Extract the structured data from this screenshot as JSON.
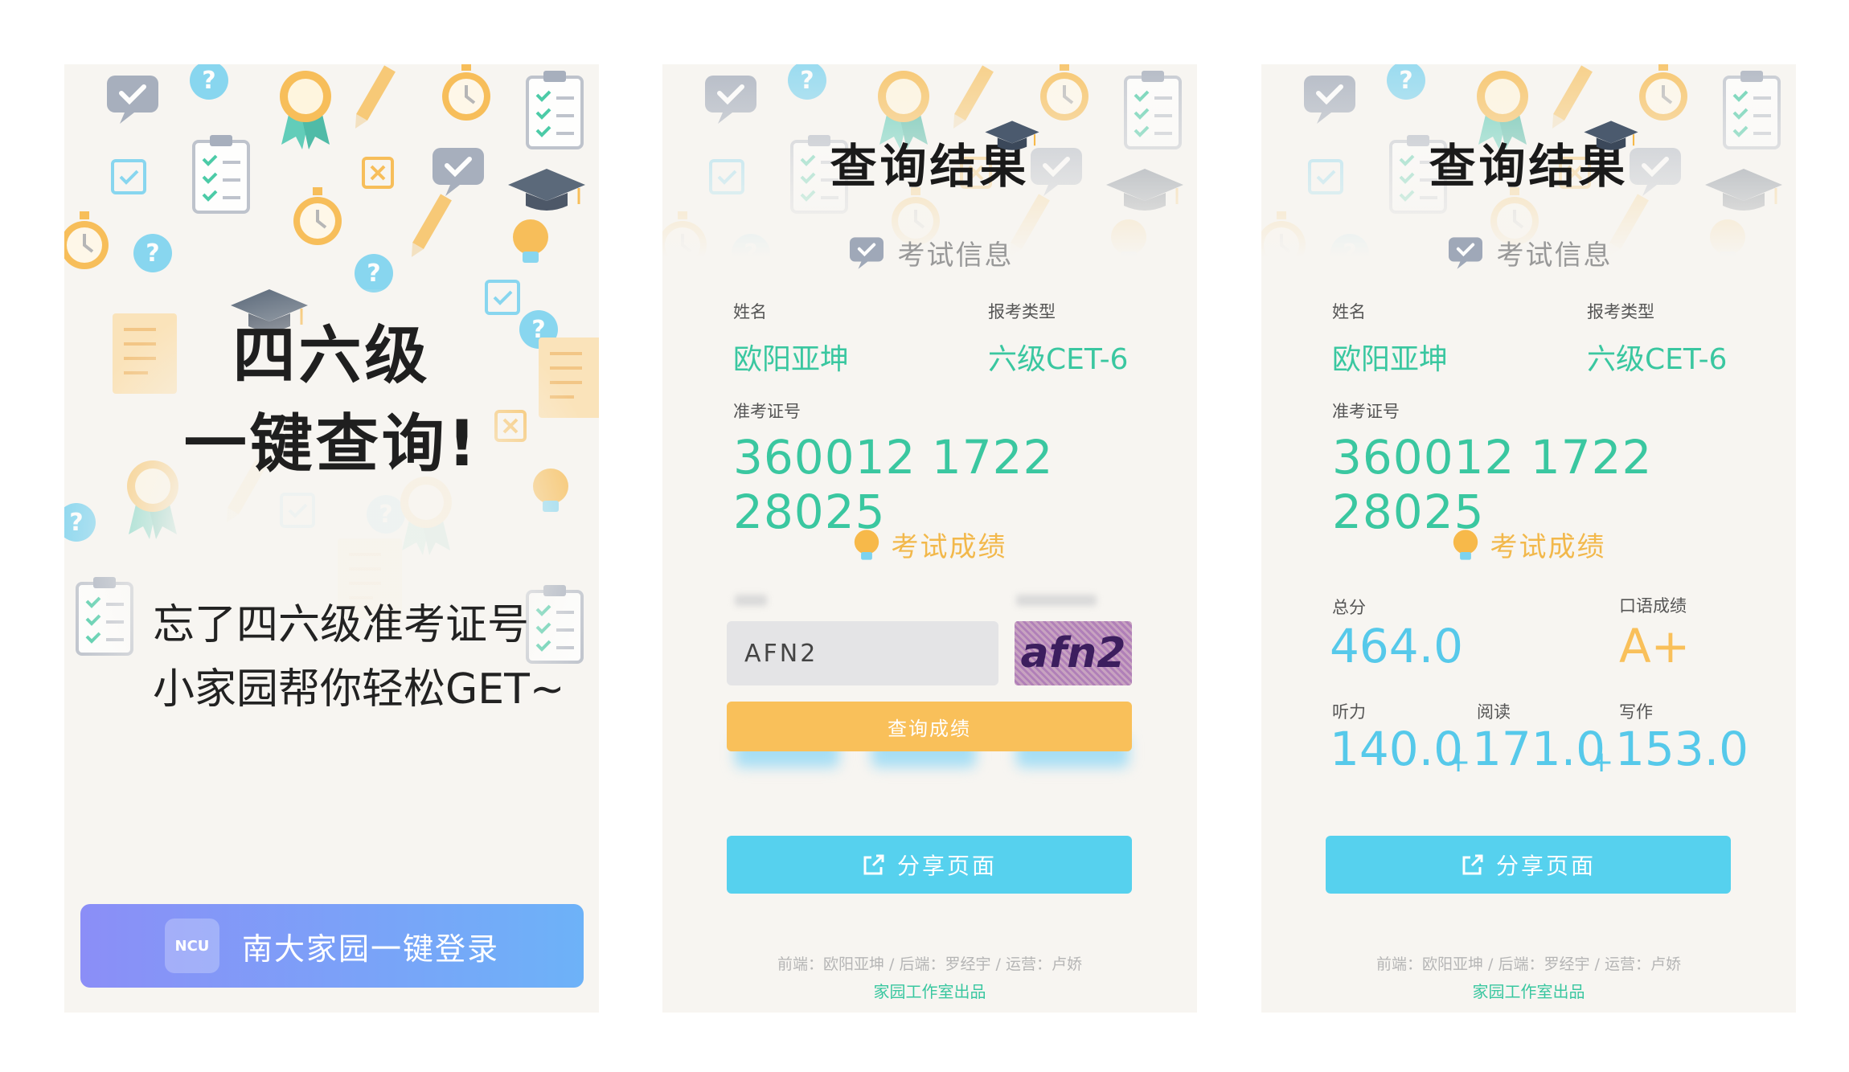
{
  "screen1": {
    "hero_line1": "四六级",
    "hero_line2": "一键查询!",
    "sub_line1": "忘了四六级准考证号",
    "sub_line2": "小家园帮你轻松GET~",
    "login_badge": "NCU",
    "login_label": "南大家园一键登录"
  },
  "result": {
    "page_title": "查询结果",
    "section_info": "考试信息",
    "label_name": "姓名",
    "value_name": "欧阳亚坤",
    "label_type": "报考类型",
    "value_type": "六级CET-6",
    "label_id": "准考证号",
    "value_id": "360012 1722 28025",
    "section_score": "考试成绩",
    "share_label": "分享页面",
    "credits": "前端：欧阳亚坤 / 后端：罗经宇 / 运营：卢娇",
    "studio": "家园工作室出品"
  },
  "captcha": {
    "input_value": "AFN2",
    "image_text": "afn2",
    "query_label": "查询成绩"
  },
  "scores": {
    "label_total": "总分",
    "value_total": "464.0",
    "label_oral": "口语成绩",
    "value_oral": "A+",
    "label_listening": "听力",
    "value_listening": "140.0",
    "label_reading": "阅读",
    "value_reading": "171.0",
    "label_writing": "写作",
    "value_writing": "153.0",
    "plus": "+"
  },
  "colors": {
    "accent_green": "#3ac7a0",
    "accent_blue": "#56d1ee",
    "accent_yellow": "#f9c05a",
    "login_gradient_start": "#8b8ef7",
    "login_gradient_end": "#6db2f8"
  },
  "icons": [
    "graduation-cap-icon",
    "check-bubble-icon",
    "question-icon",
    "medal-icon",
    "pencil-icon",
    "clipboard-icon",
    "stopwatch-icon",
    "lightbulb-icon",
    "share-icon"
  ]
}
